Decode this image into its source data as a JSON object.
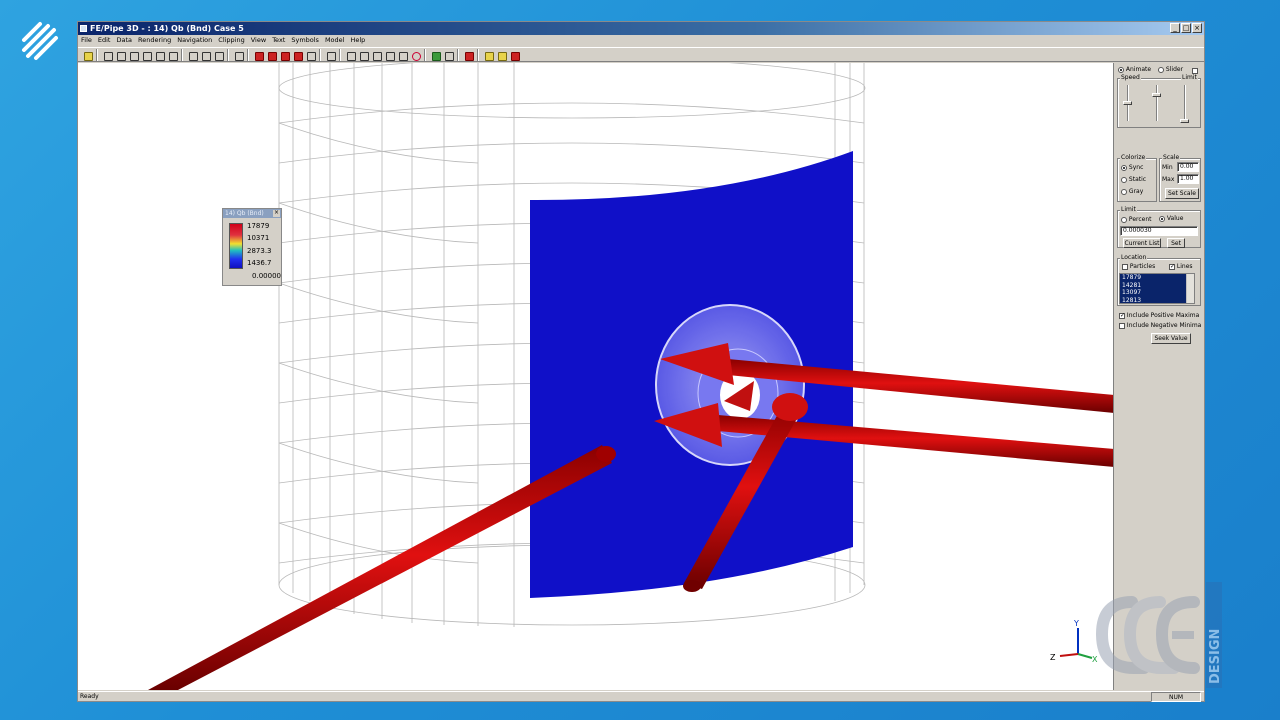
{
  "window": {
    "title": "FE/Pipe 3D - : 14) Qb (Bnd) Case 5",
    "controls": [
      "_",
      "□",
      "×"
    ]
  },
  "menu": [
    "File",
    "Edit",
    "Data",
    "Rendering",
    "Navigation",
    "Clipping",
    "View",
    "Text",
    "Symbols",
    "Model",
    "Help"
  ],
  "legend": {
    "title": "14) Qb (Bnd)",
    "close": "×",
    "values": [
      "17879",
      "10371",
      "2873.3",
      "1436.7"
    ],
    "zero": "0.00000",
    "colors": [
      "#d00018",
      "#f2e030",
      "#20c0c0",
      "#1010c0"
    ]
  },
  "panel": {
    "animate_label": "Animate",
    "slider_label": "Slider",
    "speed_label": "Speed",
    "limit_top_label": "Limit",
    "colorize_label": "Colorize",
    "sync_label": "Sync",
    "static_label": "Static",
    "gray_label": "Gray",
    "scale_label": "Scale",
    "min_label": "Min",
    "min_value": "0.00",
    "max_label": "Max",
    "max_value": "1.00",
    "set_scale_label": "Set Scale",
    "limit_label": "Limit",
    "percent_label": "Percent",
    "value_label": "Value",
    "limit_value": "0.000030",
    "current_list_label": "Current List",
    "set_label": "Set",
    "location_label": "Location",
    "particles_label": "Particles",
    "lines_label": "Lines",
    "location_list": [
      "17879",
      "14281",
      "13097",
      "12813"
    ],
    "include_positive_label": "Include Positive Maxima",
    "include_negative_label": "Include Negative Minima",
    "seek_value_label": "Seek Value"
  },
  "axes": {
    "z": "Z",
    "y": "Y",
    "x": "X"
  },
  "status": {
    "text": "Ready",
    "num": "NUM"
  },
  "watermark": {
    "vertical": "DESIGN"
  }
}
